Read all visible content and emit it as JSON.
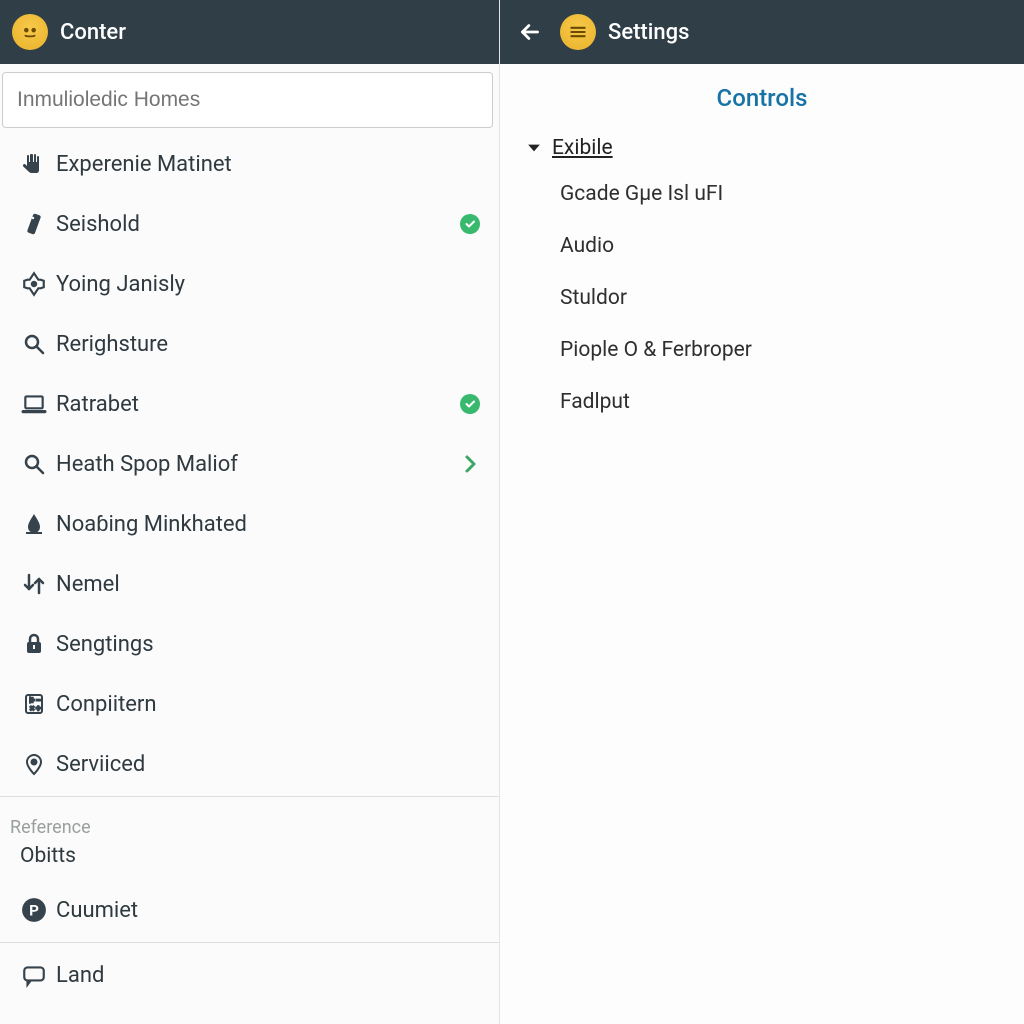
{
  "left": {
    "title": "Conter",
    "search_placeholder": "Inmulioledic Homes",
    "items": [
      {
        "icon": "hand",
        "label": "Experenie Matinet",
        "trail": ""
      },
      {
        "icon": "remote",
        "label": "Seishold",
        "trail": "check"
      },
      {
        "icon": "tag",
        "label": "Yoing Janisly",
        "trail": ""
      },
      {
        "icon": "search",
        "label": "Rerighsture",
        "trail": ""
      },
      {
        "icon": "laptop",
        "label": "Ratrabet",
        "trail": "check"
      },
      {
        "icon": "search",
        "label": "Heath Spop Maliof",
        "trail": "chev"
      },
      {
        "icon": "drop",
        "label": "Noaɓing Minkhated",
        "trail": ""
      },
      {
        "icon": "swap",
        "label": "Nemel",
        "trail": ""
      },
      {
        "icon": "lock",
        "label": "Sengtings",
        "trail": ""
      },
      {
        "icon": "calc",
        "label": "Conpiitern",
        "trail": ""
      },
      {
        "icon": "pin",
        "label": "Serviiced",
        "trail": ""
      }
    ],
    "section_label": "Reference",
    "section_sub": "Obitts",
    "items2": [
      {
        "icon": "pcircle",
        "label": "Cuumiet",
        "trail": ""
      },
      {
        "icon": "chat",
        "label": "Land",
        "trail": ""
      }
    ]
  },
  "right": {
    "title": "Settings",
    "header": "Controls",
    "group_title": "Exibile",
    "options": [
      "Gcade Gµe Isl uFI",
      "Audio",
      "Stuldor",
      "Piople O & Ferbroper",
      "Fadlput"
    ]
  }
}
